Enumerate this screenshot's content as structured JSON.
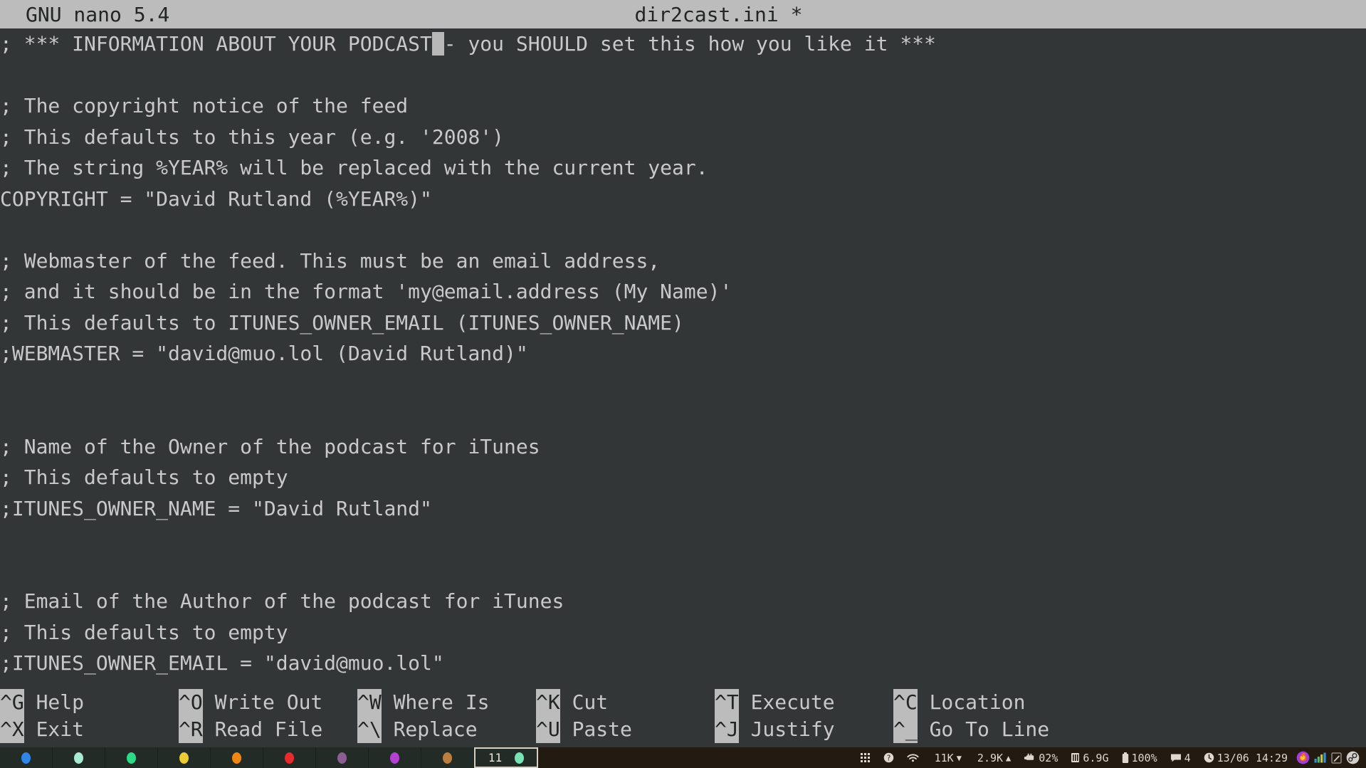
{
  "titlebar": {
    "version": "GNU nano 5.4",
    "filename": "dir2cast.ini *"
  },
  "editor": {
    "lines": [
      {
        "pre": "; *** INFORMATION ABOUT YOUR PODCAST",
        "cursor": " ",
        "post": "- you SHOULD set this how you like it ***"
      },
      {
        "pre": "",
        "cursor": "",
        "post": ""
      },
      {
        "pre": "; The copyright notice of the feed",
        "cursor": "",
        "post": ""
      },
      {
        "pre": "; This defaults to this year (e.g. '2008')",
        "cursor": "",
        "post": ""
      },
      {
        "pre": "; The string %YEAR% will be replaced with the current year.",
        "cursor": "",
        "post": ""
      },
      {
        "pre": "COPYRIGHT = \"David Rutland (%YEAR%)\"",
        "cursor": "",
        "post": ""
      },
      {
        "pre": "",
        "cursor": "",
        "post": ""
      },
      {
        "pre": "; Webmaster of the feed. This must be an email address,",
        "cursor": "",
        "post": ""
      },
      {
        "pre": "; and it should be in the format 'my@email.address (My Name)'",
        "cursor": "",
        "post": ""
      },
      {
        "pre": "; This defaults to ITUNES_OWNER_EMAIL (ITUNES_OWNER_NAME)",
        "cursor": "",
        "post": ""
      },
      {
        "pre": ";WEBMASTER = \"david@muo.lol (David Rutland)\"",
        "cursor": "",
        "post": ""
      },
      {
        "pre": "",
        "cursor": "",
        "post": ""
      },
      {
        "pre": "",
        "cursor": "",
        "post": ""
      },
      {
        "pre": "; Name of the Owner of the podcast for iTunes",
        "cursor": "",
        "post": ""
      },
      {
        "pre": "; This defaults to empty",
        "cursor": "",
        "post": ""
      },
      {
        "pre": ";ITUNES_OWNER_NAME = \"David Rutland\"",
        "cursor": "",
        "post": ""
      },
      {
        "pre": "",
        "cursor": "",
        "post": ""
      },
      {
        "pre": "",
        "cursor": "",
        "post": ""
      },
      {
        "pre": "; Email of the Author of the podcast for iTunes",
        "cursor": "",
        "post": ""
      },
      {
        "pre": "; This defaults to empty",
        "cursor": "",
        "post": ""
      },
      {
        "pre": ";ITUNES_OWNER_EMAIL = \"david@muo.lol\"",
        "cursor": "",
        "post": ""
      }
    ]
  },
  "shortcuts": {
    "row1": [
      {
        "key": "^G",
        "label": "Help"
      },
      {
        "key": "^O",
        "label": "Write Out"
      },
      {
        "key": "^W",
        "label": "Where Is"
      },
      {
        "key": "^K",
        "label": "Cut"
      },
      {
        "key": "^T",
        "label": "Execute"
      },
      {
        "key": "^C",
        "label": "Location"
      }
    ],
    "row2": [
      {
        "key": "^X",
        "label": "Exit"
      },
      {
        "key": "^R",
        "label": "Read File"
      },
      {
        "key": "^\\",
        "label": "Replace"
      },
      {
        "key": "^U",
        "label": "Paste"
      },
      {
        "key": "^J",
        "label": "Justify"
      },
      {
        "key": "^_",
        "label": "Go To Line"
      }
    ]
  },
  "taskbar": {
    "workspaces": [
      {
        "color": "#2f86e8"
      },
      {
        "color": "#a8ebd2"
      },
      {
        "color": "#2ddb86"
      },
      {
        "color": "#edcb34"
      },
      {
        "color": "#f08713"
      },
      {
        "color": "#e62b2b"
      },
      {
        "color": "#8c5d92"
      },
      {
        "color": "#b441d4"
      },
      {
        "color": "#bb7d40"
      }
    ],
    "active_workspace": {
      "number": "11",
      "color": "#79e3b5"
    },
    "tray": [
      {
        "icon": "grid-icon",
        "value": ""
      },
      {
        "icon": "help-icon",
        "value": ""
      },
      {
        "icon": "wifi-icon",
        "value": ""
      },
      {
        "icon": "download-icon",
        "value": "11K"
      },
      {
        "icon": "upload-icon",
        "value": "2.9K"
      },
      {
        "icon": "cpu-icon",
        "value": "02%"
      },
      {
        "icon": "memory-icon",
        "value": "6.9G"
      },
      {
        "icon": "battery-icon",
        "value": "100%"
      },
      {
        "icon": "message-icon",
        "value": "4"
      },
      {
        "icon": "clock-icon",
        "value": "13/06 14:29"
      }
    ],
    "tray_apps": [
      {
        "icon": "firefox-icon"
      },
      {
        "icon": "signal-bars-icon"
      },
      {
        "icon": "edit-pen-icon"
      },
      {
        "icon": "steam-icon"
      }
    ]
  }
}
